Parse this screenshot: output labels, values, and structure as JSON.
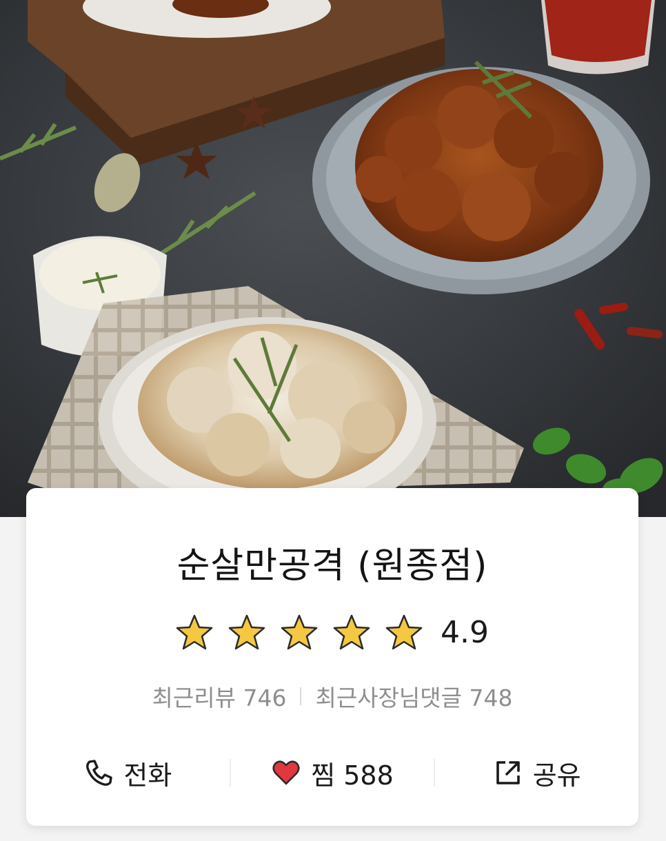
{
  "store": {
    "name": "순살만공격 (원종점)",
    "rating": "4.9",
    "star_count": 5,
    "recent_reviews_label": "최근리뷰 746",
    "recent_owner_replies_label": "최근사장님댓글 748"
  },
  "actions": {
    "call_label": "전화",
    "favorite_label": "찜 588",
    "share_label": "공유"
  },
  "icons": {
    "call": "phone-icon",
    "favorite": "heart-icon",
    "share": "share-icon",
    "star": "star-icon"
  },
  "colors": {
    "star_fill": "#f5c842",
    "heart_fill": "#e0383e",
    "text_primary": "#141414",
    "text_secondary": "#8e8e8e"
  }
}
